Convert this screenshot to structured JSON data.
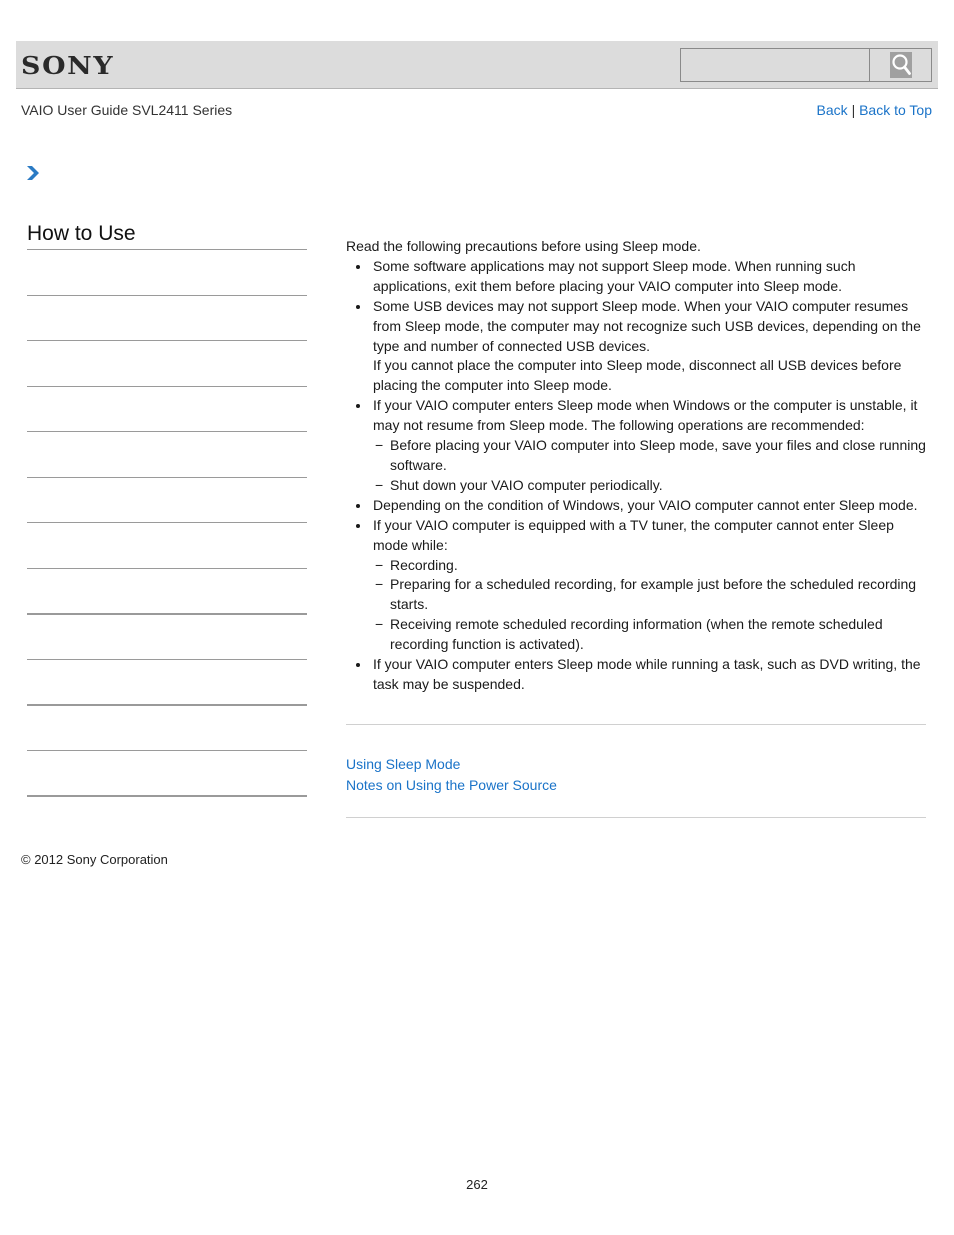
{
  "header": {
    "brand": "SONY",
    "search": {
      "value": "",
      "placeholder": "",
      "button_icon": "search-icon"
    }
  },
  "subheader": {
    "title": "VAIO User Guide SVL2411 Series",
    "links": {
      "back": "Back",
      "separator": "|",
      "back_to_top": "Back to Top"
    }
  },
  "breadcrumb": {
    "icon": "chevron-right-icon",
    "accent_color": "#2b7bc4"
  },
  "sidebar": {
    "title": "How to Use",
    "item_count": 12
  },
  "main": {
    "intro": "Read the following precautions before using Sleep mode.",
    "bullets": [
      {
        "text": "Some software applications may not support Sleep mode. When running such applications, exit them before placing your VAIO computer into Sleep mode."
      },
      {
        "text": "Some USB devices may not support Sleep mode. When your VAIO computer resumes from Sleep mode, the computer may not recognize such USB devices, depending on the type and number of connected USB devices.",
        "extra": "If you cannot place the computer into Sleep mode, disconnect all USB devices before placing the computer into Sleep mode."
      },
      {
        "text": "If your VAIO computer enters Sleep mode when Windows or the computer is unstable, it may not resume from Sleep mode. The following operations are recommended:",
        "subitems": [
          "Before placing your VAIO computer into Sleep mode, save your files and close running software.",
          "Shut down your VAIO computer periodically."
        ]
      },
      {
        "text": "Depending on the condition of Windows, your VAIO computer cannot enter Sleep mode."
      },
      {
        "text": "If your VAIO computer is equipped with a TV tuner, the computer cannot enter Sleep mode while:",
        "subitems": [
          "Recording.",
          "Preparing for a scheduled recording, for example just before the scheduled recording starts.",
          "Receiving remote scheduled recording information (when the remote scheduled recording function is activated)."
        ]
      },
      {
        "text": "If your VAIO computer enters Sleep mode while running a task, such as DVD writing, the task may be suspended."
      }
    ]
  },
  "related_links": [
    "Using Sleep Mode",
    "Notes on Using the Power Source"
  ],
  "footer": {
    "copyright": "© 2012 Sony Corporation"
  },
  "page_number": "262",
  "colors": {
    "link": "#1a73c8",
    "header_bg": "#dcdcdc"
  }
}
